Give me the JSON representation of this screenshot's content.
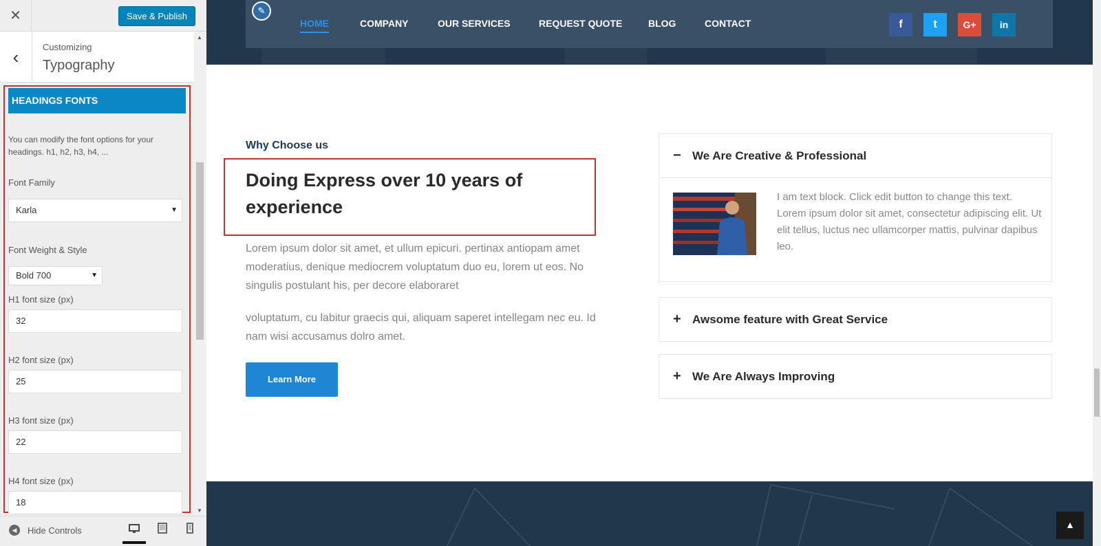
{
  "customizer": {
    "close_icon": "close-icon",
    "save_button": "Save & Publish",
    "customizing_label": "Customizing",
    "section_title": "Typography",
    "panel_header": "HEADINGS FONTS",
    "description": "You can modify the font options for your headings. h1, h2, h3, h4, ...",
    "font_family_label": "Font Family",
    "font_family_value": "Karla",
    "font_weight_label": "Font Weight & Style",
    "font_weight_value": "Bold 700",
    "h1_label": "H1 font size (px)",
    "h1_value": "32",
    "h2_label": "H2 font size (px)",
    "h2_value": "25",
    "h3_label": "H3 font size (px)",
    "h3_value": "22",
    "h4_label": "H4 font size (px)",
    "h4_value": "18",
    "hide_controls": "Hide Controls",
    "accent_color": "#0085ba"
  },
  "site": {
    "nav": {
      "items": [
        "HOME",
        "COMPANY",
        "OUR SERVICES",
        "REQUEST QUOTE",
        "BLOG",
        "CONTACT"
      ],
      "active": "HOME"
    },
    "social": [
      {
        "icon": "facebook-icon",
        "glyph": "f",
        "color": "#3b5998"
      },
      {
        "icon": "twitter-icon",
        "glyph": "t",
        "color": "#1da1f2"
      },
      {
        "icon": "google-plus-icon",
        "glyph": "G+",
        "color": "#dd4b39"
      },
      {
        "icon": "linkedin-icon",
        "glyph": "in",
        "color": "#0e76a8"
      }
    ],
    "why_label": "Why Choose us",
    "heading": "Doing Express over 10 years of experience",
    "paragraph1": "Lorem ipsum dolor sit amet, et ullum epicuri. pertinax antiopam amet moderatius, denique mediocrem voluptatum duo eu, lorem ut eos. No singulis postulant his, per decore elaboraret",
    "paragraph2": "voluptatum, cu labitur graecis qui, aliquam saperet intellegam nec eu. Id nam wisi accusamus dolro amet.",
    "learn_more": "Learn More",
    "accordion": [
      {
        "title": "We Are Creative & Professional",
        "sign": "−",
        "body": "I am text block. Click edit button to change this text. Lorem ipsum dolor sit amet, consectetur adipiscing elit. Ut elit tellus, luctus nec ullamcorper mattis, pulvinar dapibus leo."
      },
      {
        "title": "Awsome feature with Great Service",
        "sign": "+"
      },
      {
        "title": "We Are Always Improving",
        "sign": "+"
      }
    ],
    "primary_color": "#1f86d6",
    "dark_color": "#21374c"
  }
}
